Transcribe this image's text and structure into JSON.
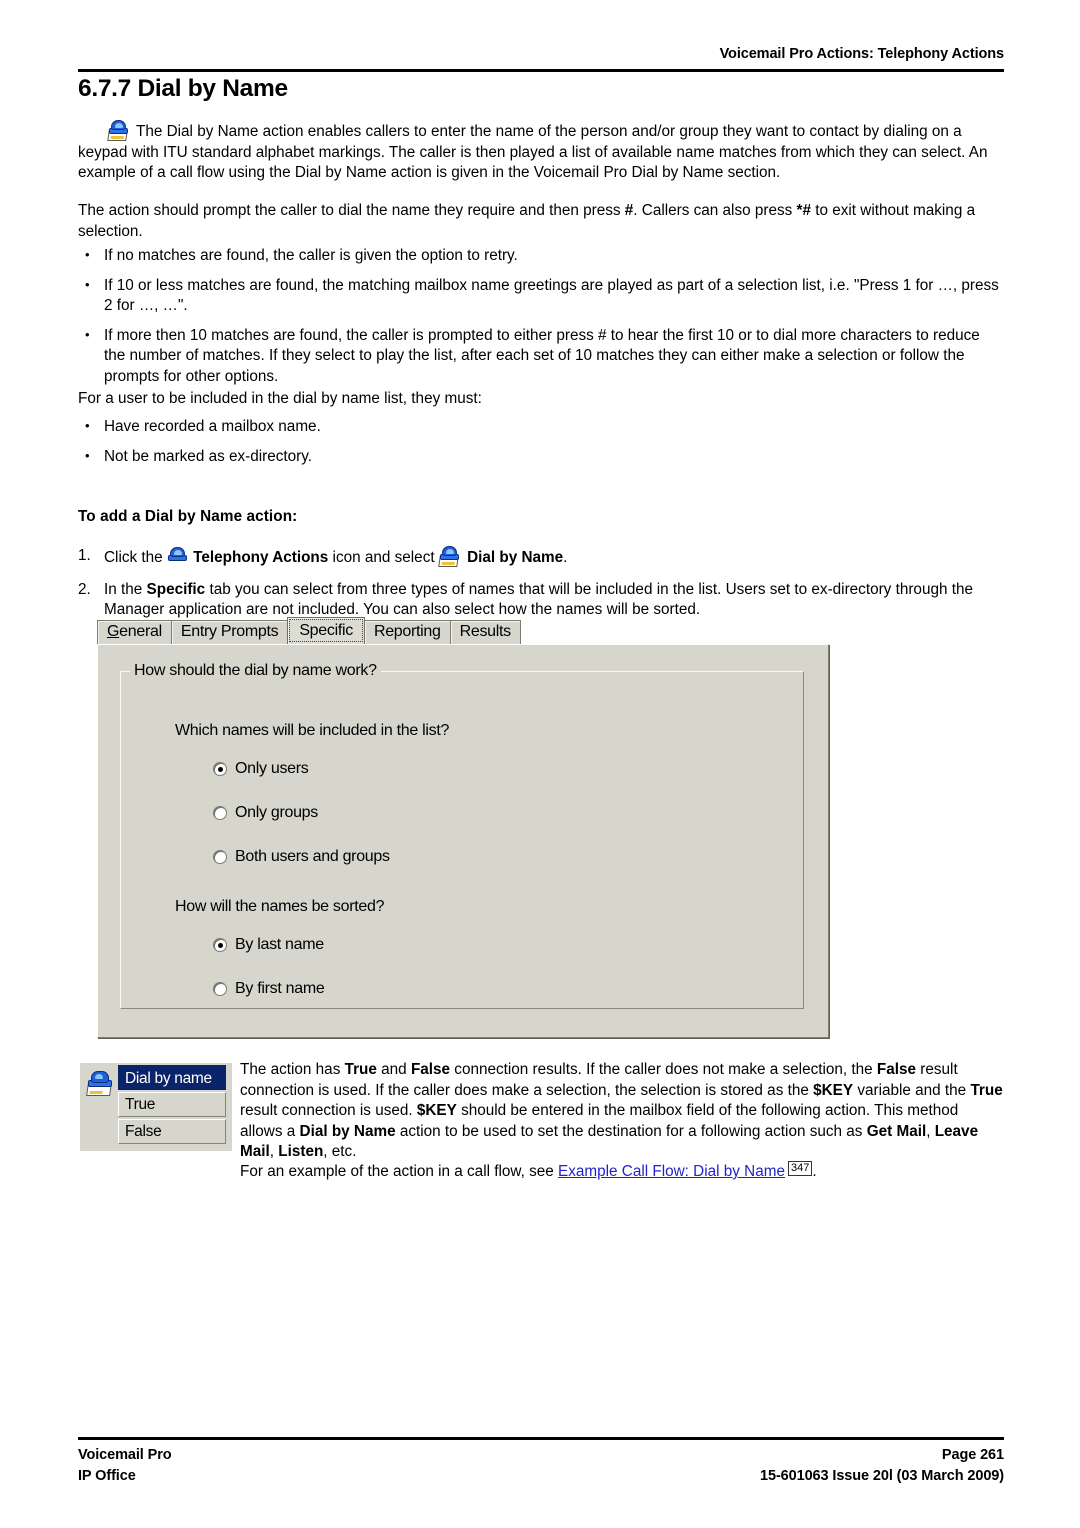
{
  "header": {
    "running_head": "Voicemail Pro Actions: Telephony Actions"
  },
  "section": {
    "number_and_title": "6.7.7 Dial by Name"
  },
  "intro": {
    "paragraph1": "The Dial by Name action enables callers to enter the name of the person and/or group they want to contact by dialing on a keypad with ITU standard alphabet markings. The caller is then played a list of available name matches from which they can select. An example of a call flow using the Dial by Name action is given in the Voicemail Pro Dial by Name section.",
    "paragraph2_a": "The action should prompt the caller to dial the name they require and then press ",
    "paragraph2_hash": "#",
    "paragraph2_b": ". Callers can also press ",
    "paragraph2_starhash": "*#",
    "paragraph2_c": " to exit without making a selection.",
    "icon": "telephony-dial-by-name-icon"
  },
  "behavior_bullets": [
    "If no matches are found, the caller is given the option to retry.",
    "If 10 or less matches are found, the matching mailbox name greetings are played as part of a selection list, i.e. \"Press 1 for …, press 2 for …, …\".",
    "If more then 10 matches are found, the caller is prompted to either press # to hear the first 10 or to dial more characters to reduce the number of matches. If they select to play the list, after each set of 10 matches they can either make a selection or follow the prompts for other options."
  ],
  "inclusion": {
    "lead_in": "For a user to be included in the dial by name list, they must:",
    "bullets": [
      "Have recorded a mailbox name.",
      "Not be marked as ex-directory."
    ]
  },
  "procedure": {
    "heading": "To add a Dial by Name action:",
    "step1": {
      "number": "1.",
      "text_a": "Click the ",
      "bold_1": "Telephony Actions",
      "text_b": " icon and select ",
      "bold_2": "Dial by Name",
      "text_c": ".",
      "icon_1": "telephony-actions-icon",
      "icon_2": "dial-by-name-icon"
    },
    "step2": {
      "number": "2.",
      "text_a": "In the ",
      "bold_1": "Specific",
      "text_b": " tab you can select from three types of names that will be included in the list. Users set to ex-directory through the Manager application are not included. You can also select how the names will be sorted."
    }
  },
  "dialog": {
    "tabs": [
      {
        "label": "General",
        "accel": "G",
        "selected": false
      },
      {
        "label": "Entry Prompts",
        "accel": "",
        "selected": false
      },
      {
        "label": "Specific",
        "accel": "",
        "selected": true
      },
      {
        "label": "Reporting",
        "accel": "g",
        "selected": false
      },
      {
        "label": "Results",
        "accel": "",
        "selected": false
      }
    ],
    "groupbox_legend": "How should the dial by name work?",
    "question_1": "Which names will be included in the list?",
    "options_1": [
      {
        "label": "Only users",
        "selected": true
      },
      {
        "label": "Only groups",
        "selected": false
      },
      {
        "label": "Both users and groups",
        "selected": false
      }
    ],
    "question_2": "How will the names be sorted?",
    "options_2": [
      {
        "label": "By last name",
        "selected": true
      },
      {
        "label": "By first name",
        "selected": false
      }
    ],
    "colors": {
      "face": "#d6d6cd",
      "title_bar": "#0a246a"
    }
  },
  "node_graphic": {
    "icon": "dial-by-name-icon",
    "title": "Dial by name",
    "rows": [
      "True",
      "False"
    ]
  },
  "results_text": {
    "seg_a": "The action has ",
    "b_true_1": "True",
    "seg_b": " and ",
    "b_false_1": "False",
    "seg_c": " connection results. If the caller does not make a selection, the ",
    "b_false_2": "False",
    "seg_d": " result connection is used. If the caller does make a selection, the selection is stored as the ",
    "b_key_1": "$KEY",
    "seg_e": " variable and the ",
    "b_true_2": "True",
    "seg_f": " result connection is used. ",
    "b_key_2": "$KEY",
    "seg_g": " should be entered in the mailbox field of the following action. This method allows a ",
    "b_dbn": "Dial by Name",
    "seg_h": " action to be used to set the destination for a following action such as ",
    "b_getmail": "Get Mail",
    "seg_i": ", ",
    "b_leavemail": "Leave Mail",
    "seg_j": ", ",
    "b_listen": "Listen",
    "seg_k": ", etc."
  },
  "example_link": {
    "lead": "For an example of the action in a call flow, see ",
    "link_text": "Example Call Flow: Dial by Name",
    "page_ref": "347",
    "trail": "."
  },
  "footer": {
    "left_line1": "Voicemail Pro",
    "left_line2": "IP Office",
    "right_line1": "Page 261",
    "right_line2": "15-601063 Issue 20l (03 March 2009)"
  }
}
